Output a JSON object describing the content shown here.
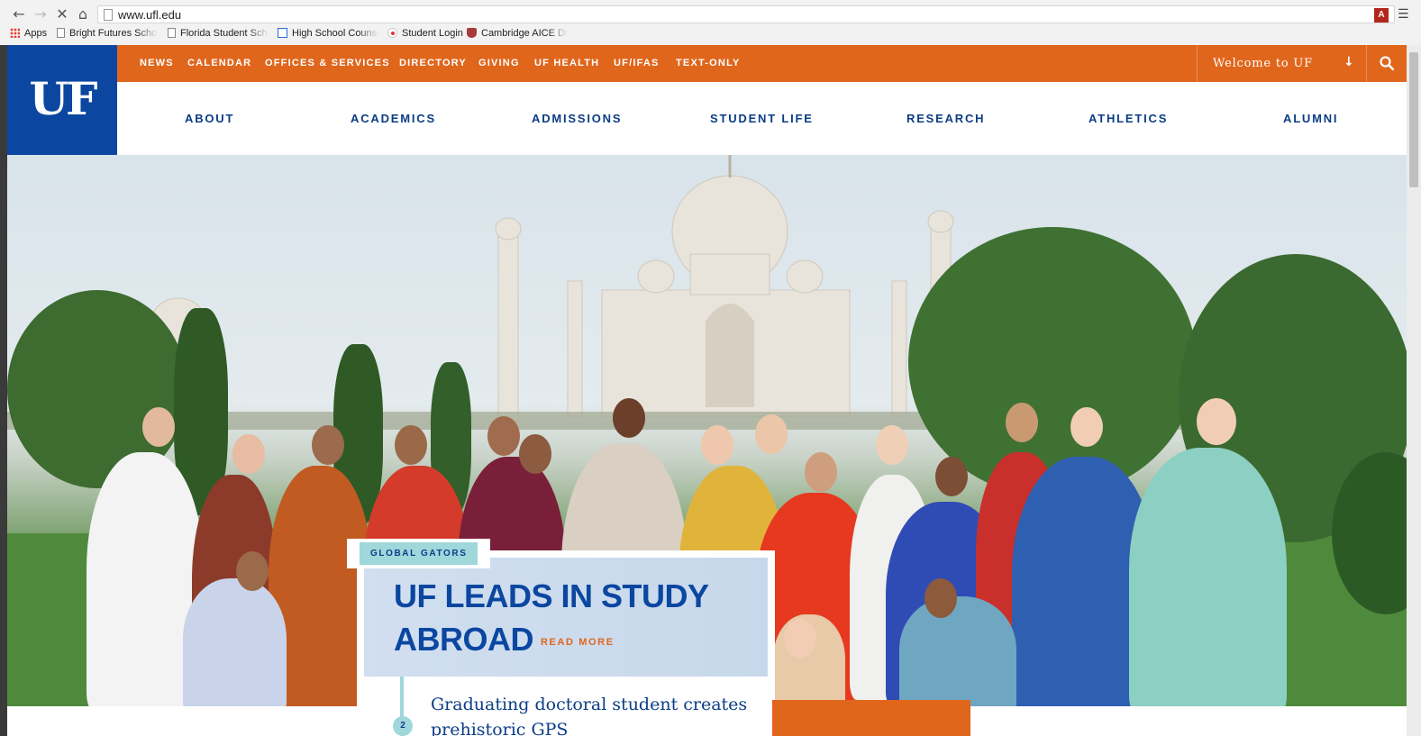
{
  "browser": {
    "url": "www.ufl.edu",
    "nav": {
      "back": "←",
      "forward": "→",
      "stop": "✕",
      "home": "⌂"
    },
    "bookmarks": [
      {
        "label": "Apps",
        "icon": "apps-grid-icon"
      },
      {
        "label": "Bright Futures Schola",
        "icon": "page-icon"
      },
      {
        "label": "Florida Student Schol",
        "icon": "page-icon"
      },
      {
        "label": "High School Counsel",
        "icon": "calendar-icon"
      },
      {
        "label": "Student Login",
        "icon": "student-login-icon"
      },
      {
        "label": "Cambridge AICE Dipl",
        "icon": "cambridge-icon"
      }
    ]
  },
  "site": {
    "logo_text": "UF",
    "colors": {
      "blue": "#0b47a0",
      "orange": "#e0661c",
      "teal": "#9fd7db"
    },
    "top_links": [
      "NEWS",
      "CALENDAR",
      "OFFICES & SERVICES",
      "DIRECTORY",
      "GIVING",
      "UF HEALTH",
      "UF/IFAS",
      "TEXT-ONLY"
    ],
    "welcome_label": "Welcome to UF",
    "welcome_arrow": "↓",
    "main_nav": [
      "ABOUT",
      "ACADEMICS",
      "ADMISSIONS",
      "STUDENT LIFE",
      "RESEARCH",
      "ATHLETICS",
      "ALUMNI"
    ],
    "feature": {
      "badge": "GLOBAL GATORS",
      "headline_line1": "UF LEADS IN STUDY",
      "headline_line2": "ABROAD",
      "read_more": "READ MORE"
    },
    "teaser": {
      "number": "2",
      "text": "Graduating doctoral student creates prehistoric GPS"
    }
  }
}
